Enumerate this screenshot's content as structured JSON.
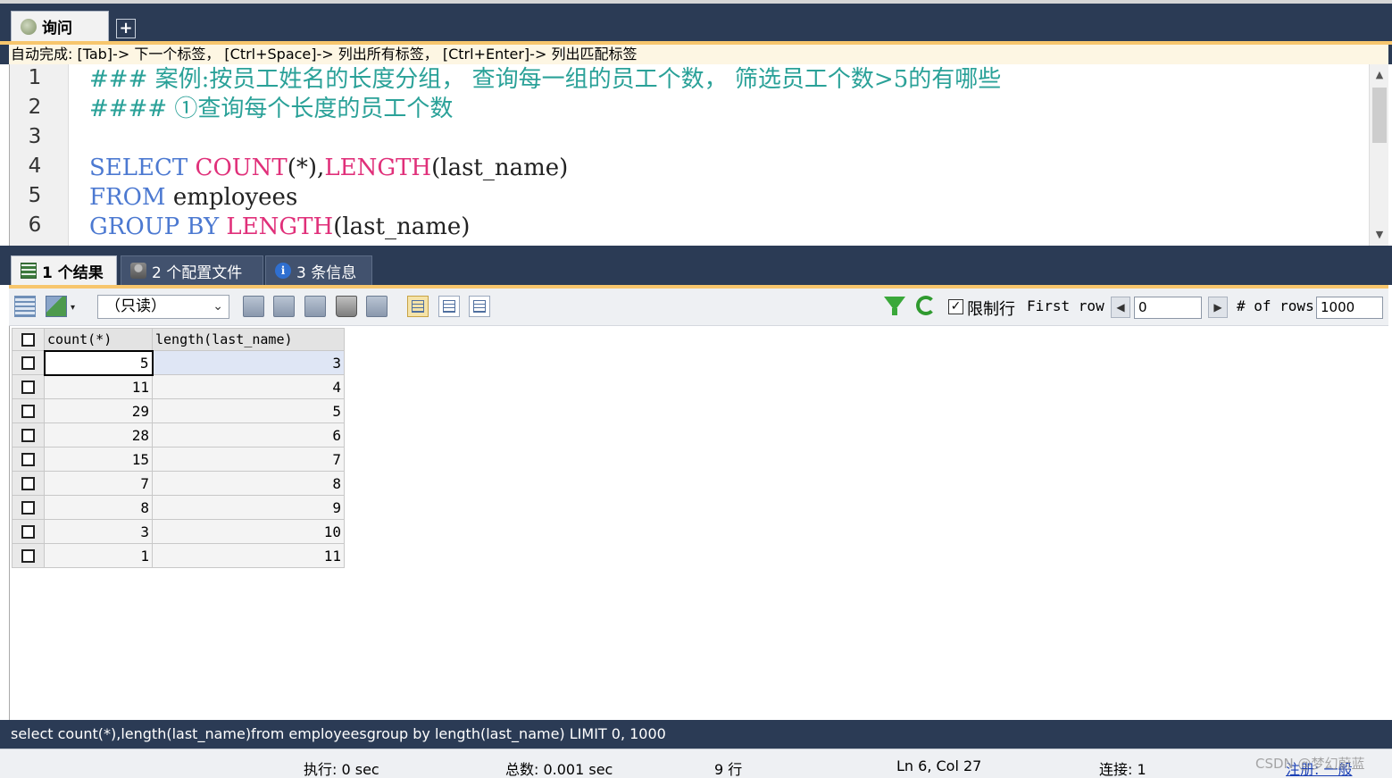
{
  "query_tab": {
    "label": "询问",
    "add_label": "+"
  },
  "hint": "自动完成:  [Tab]-> 下一个标签， [Ctrl+Space]-> 列出所有标签， [Ctrl+Enter]-> 列出匹配标签",
  "editor": {
    "line_numbers": [
      "1",
      "2",
      "3",
      "4",
      "5",
      "6"
    ],
    "lines": [
      [
        {
          "t": "### 案例:按员工姓名的长度分组， 查询每一组的员工个数， 筛选员工个数>5的有哪些",
          "c": "cmt"
        }
      ],
      [
        {
          "t": "#### ①查询每个长度的员工个数",
          "c": "cmt"
        }
      ],
      [],
      [
        {
          "t": "SELECT ",
          "c": "kw"
        },
        {
          "t": "COUNT",
          "c": "fn"
        },
        {
          "t": "(*),",
          "c": "plain"
        },
        {
          "t": "LENGTH",
          "c": "fn"
        },
        {
          "t": "(last_name)",
          "c": "plain"
        }
      ],
      [
        {
          "t": "FROM ",
          "c": "kw"
        },
        {
          "t": "employees",
          "c": "plain"
        }
      ],
      [
        {
          "t": "GROUP BY ",
          "c": "kw"
        },
        {
          "t": "LENGTH",
          "c": "fn"
        },
        {
          "t": "(last_name)",
          "c": "plain"
        }
      ]
    ]
  },
  "result_tabs": [
    {
      "label": "1 个结果",
      "icon": "result-grid-icon"
    },
    {
      "label": "2 个配置文件",
      "icon": "profile-icon"
    },
    {
      "label": "3 条信息",
      "icon": "info-icon",
      "glyph": "i"
    }
  ],
  "toolbar": {
    "readonly_select": "（只读）",
    "limit_label": "限制行",
    "limit_checked": true,
    "first_row_label": "First row",
    "first_row_value": "0",
    "rows_label": "# of rows",
    "rows_value": "1000",
    "prev_glyph": "◀",
    "next_glyph": "▶",
    "caret_glyph": "▾",
    "check_glyph": "✓"
  },
  "grid": {
    "columns": [
      "count(*)",
      "length(last_name)"
    ],
    "rows": [
      [
        "5",
        "3"
      ],
      [
        "11",
        "4"
      ],
      [
        "29",
        "5"
      ],
      [
        "28",
        "6"
      ],
      [
        "15",
        "7"
      ],
      [
        "7",
        "8"
      ],
      [
        "8",
        "9"
      ],
      [
        "3",
        "10"
      ],
      [
        "1",
        "11"
      ]
    ]
  },
  "sql_status": "select count(*),length(last_name)from employeesgroup by length(last_name) LIMIT 0, 1000",
  "status": {
    "exec": "执行: 0 sec",
    "total": "总数: 0.001 sec",
    "rows": "9 行",
    "position": "Ln 6, Col 27",
    "connections": "连接: 1",
    "register": "注册: 一般",
    "watermark": "CSDN @梦幻蔚蓝"
  },
  "colors": {
    "frame": "#2b3b55",
    "accent_strip": "#f7c66d",
    "comment": "#2aa198",
    "keyword": "#4c79d1",
    "function": "#e0307a"
  }
}
